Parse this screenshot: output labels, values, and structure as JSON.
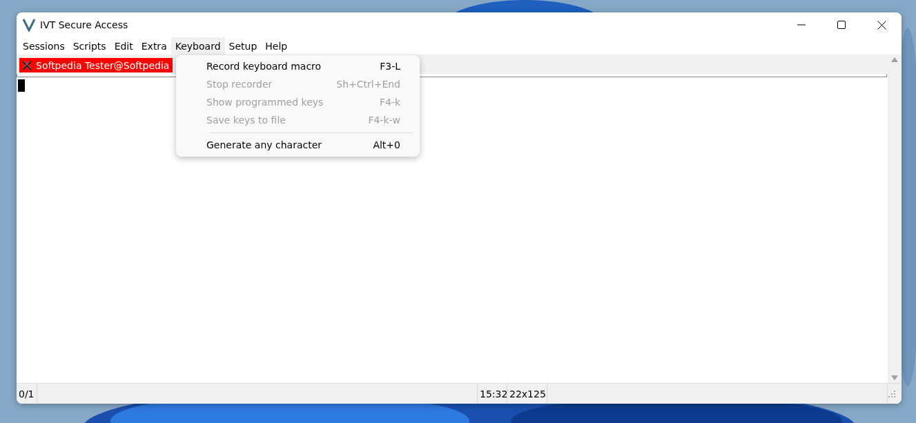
{
  "window": {
    "title": "IVT Secure Access"
  },
  "menu_bar": [
    {
      "label": "Sessions",
      "selected": false
    },
    {
      "label": "Scripts",
      "selected": false
    },
    {
      "label": "Edit",
      "selected": false
    },
    {
      "label": "Extra",
      "selected": false
    },
    {
      "label": "Keyboard",
      "selected": true
    },
    {
      "label": "Setup",
      "selected": false
    },
    {
      "label": "Help",
      "selected": false
    }
  ],
  "session_tabs": [
    {
      "label": "Softpedia Tester@Softpedia",
      "selected": true
    }
  ],
  "dropdown": [
    {
      "kind": "item",
      "label": "Record keyboard macro",
      "shortcut": "F3-L",
      "disabled": false
    },
    {
      "kind": "item",
      "label": "Stop recorder",
      "shortcut": "Sh+Ctrl+End",
      "disabled": true
    },
    {
      "kind": "item",
      "label": "Show programmed keys",
      "shortcut": "F4-k",
      "disabled": true
    },
    {
      "kind": "item",
      "label": "Save keys to file",
      "shortcut": "F4-k-w",
      "disabled": true
    },
    {
      "kind": "separator"
    },
    {
      "kind": "item",
      "label": "Generate any character",
      "shortcut": "Alt+0",
      "disabled": false
    }
  ],
  "status_bar": {
    "position": "0/1",
    "time": "15:32",
    "size": "22x125"
  }
}
